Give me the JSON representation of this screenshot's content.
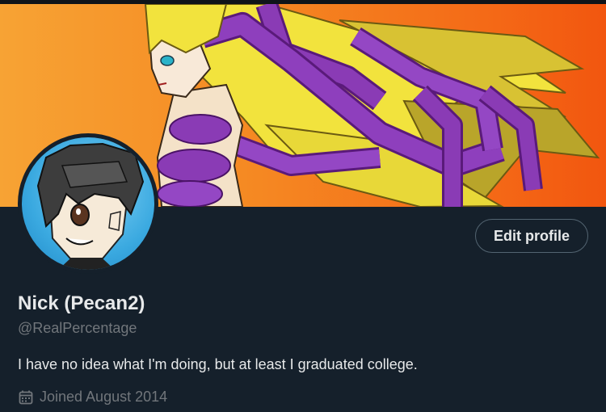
{
  "profile": {
    "display_name": "Nick (Pecan2)",
    "handle": "@RealPercentage",
    "bio": "I have no idea what I'm doing, but at least I graduated college.",
    "joined": "Joined August 2014",
    "edit_button_label": "Edit profile"
  },
  "icons": {
    "joined": "calendar-icon"
  },
  "colors": {
    "background": "#15202b",
    "primary_text": "#e7e9ea",
    "secondary_text": "#71767b",
    "button_border": "#536471"
  }
}
